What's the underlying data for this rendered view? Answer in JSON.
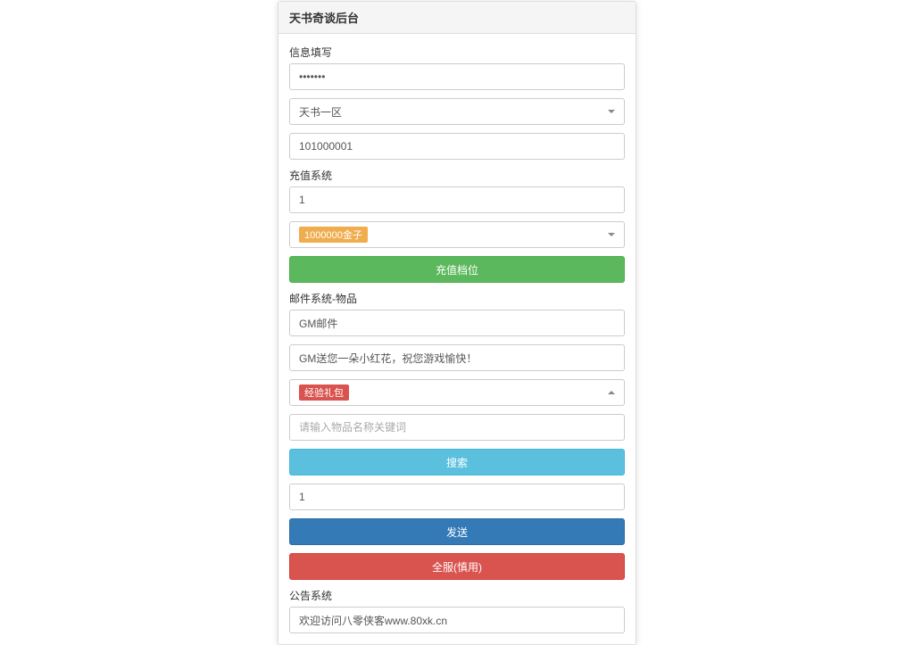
{
  "header": {
    "title": "天书奇谈后台"
  },
  "info_section": {
    "label": "信息填写",
    "password_value": "•••••••",
    "zone_dropdown": "天书一区",
    "id_value": "101000001"
  },
  "recharge_section": {
    "label": "充值系统",
    "amount_value": "1",
    "gold_dropdown": "1000000金子",
    "recharge_button": "充值档位"
  },
  "mail_section": {
    "label": "邮件系统-物品",
    "title_value": "GM邮件",
    "content_value": "GM送您一朵小红花，祝您游戏愉快！",
    "item_dropdown": "经验礼包",
    "search_placeholder": "请输入物品名称关键词",
    "search_button": "搜索",
    "quantity_value": "1",
    "send_button": "发送",
    "all_server_button": "全服(慎用)"
  },
  "notice_section": {
    "label": "公告系统",
    "content_value": "欢迎访问八零侠客www.80xk.cn"
  }
}
